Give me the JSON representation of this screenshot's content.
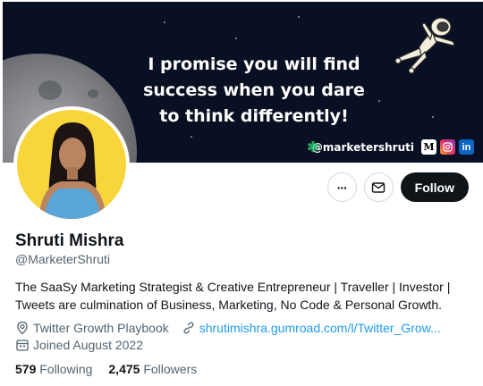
{
  "banner": {
    "quote_line1": "I promise you will find",
    "quote_line2": "success when you dare",
    "quote_line3": "to think differently!",
    "handle": "@marketershruti",
    "social_icons": [
      "medium-icon",
      "instagram-icon",
      "linkedin-icon",
      "linktree-icon"
    ],
    "medium_letter": "M",
    "linkedin_letters": "in",
    "linktree_glyph": "✱"
  },
  "profile": {
    "name": "Shruti Mishra",
    "username": "@MarketerShruti",
    "bio_line1": "The SaaSy Marketing Strategist & Creative Entrepreneur | Traveller | Investor |",
    "bio_line2": "Tweets are culmination of Business, Marketing, No Code & Personal Growth.",
    "location": "Twitter Growth Playbook",
    "website": "shrutimishra.gumroad.com/l/Twitter_Grow...",
    "joined": "Joined August 2022",
    "following_count": "579",
    "following_label": "Following",
    "followers_count": "2,475",
    "followers_label": "Followers"
  },
  "actions": {
    "more_glyph": "···",
    "follow_label": "Follow"
  },
  "colors": {
    "accent_link": "#1d9bf0",
    "follow_bg": "#0f1419",
    "banner_bg": "#0a1023",
    "avatar_bg": "#f8d53a",
    "secondary_text": "#536471"
  }
}
